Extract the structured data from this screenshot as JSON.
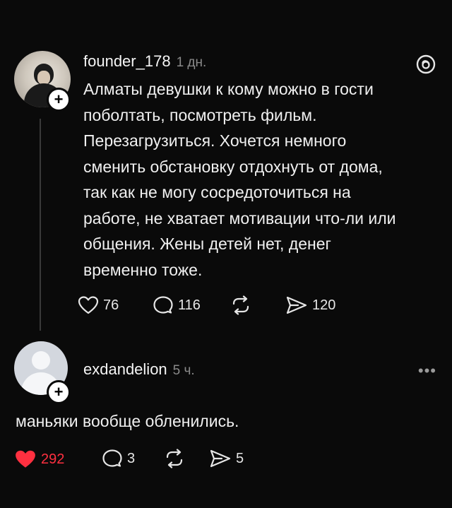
{
  "post": {
    "username": "founder_178",
    "time": "1 дн.",
    "lines": [
      "Алматы девушки к кому можно в гости",
      "поболтать, посмотреть фильм.",
      "Перезагрузиться. Хочется немного",
      "сменить обстановку отдохнуть от дома,",
      "так как не могу сосредоточиться на",
      "работе, не хватает мотивации что-ли или",
      "общения. Жены детей нет, денег",
      "временно тоже."
    ],
    "likes": "76",
    "comments": "116",
    "shares": "120"
  },
  "reply": {
    "username": "exdandelion",
    "time": "5 ч.",
    "text": "маньяки вообще обленились.",
    "likes": "292",
    "comments": "3",
    "shares": "5",
    "like_color": "#ff3040"
  },
  "icons": [
    "heart-icon",
    "comment-icon",
    "repost-icon",
    "share-icon",
    "threads-logo-icon",
    "more-icon",
    "plus-icon"
  ]
}
